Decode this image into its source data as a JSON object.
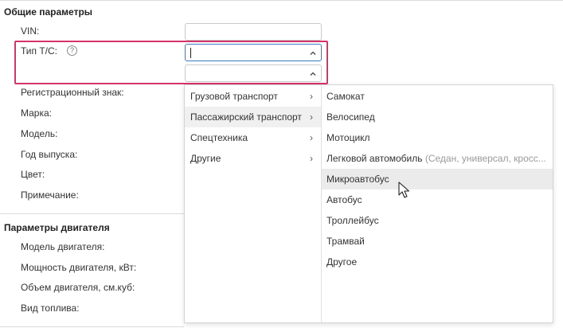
{
  "sections": {
    "general": {
      "title": "Общие параметры",
      "vin_label": "VIN:",
      "vehicle_type_label": "Тип Т/С:",
      "registration_label": "Регистрационный знак:",
      "brand_label": "Марка:",
      "model_label": "Модель:",
      "year_label": "Год выпуска:",
      "color_label": "Цвет:",
      "note_label": "Примечание:"
    },
    "engine": {
      "title": "Параметры двигателя",
      "engine_model_label": "Модель двигателя:",
      "power_label": "Мощность двигателя, кВт:",
      "volume_label": "Объем двигателя, см.куб:",
      "fuel_label": "Вид топлива:"
    }
  },
  "icons": {
    "help": "question-circle-icon",
    "chevron": "chevron-up-icon",
    "submenu": "chevron-right-icon",
    "cursor": "mouse-pointer-icon"
  },
  "help_glyph": "?",
  "dropdown": {
    "categories": [
      {
        "label": "Грузовой транспорт",
        "arrow": "›"
      },
      {
        "label": "Пассажирский транспорт",
        "arrow": "›"
      },
      {
        "label": "Спецтехника",
        "arrow": "›"
      },
      {
        "label": "Другие",
        "arrow": "›"
      }
    ],
    "active_category": "Пассажирский транспорт",
    "options": [
      {
        "label": "Самокат",
        "hint": ""
      },
      {
        "label": "Велосипед",
        "hint": ""
      },
      {
        "label": "Мотоцикл",
        "hint": ""
      },
      {
        "label": "Легковой автомобиль",
        "hint": " (Седан, универсал, кросс..."
      },
      {
        "label": "Микроавтобус",
        "hint": ""
      },
      {
        "label": "Автобус",
        "hint": ""
      },
      {
        "label": "Троллейбус",
        "hint": ""
      },
      {
        "label": "Трамвай",
        "hint": ""
      },
      {
        "label": "Другое",
        "hint": ""
      }
    ],
    "hovered_option": "Микроавтобус"
  },
  "colors": {
    "highlight": "#d6336c",
    "focus_border": "#3b7bbf",
    "hover_bg": "#ebebeb"
  }
}
